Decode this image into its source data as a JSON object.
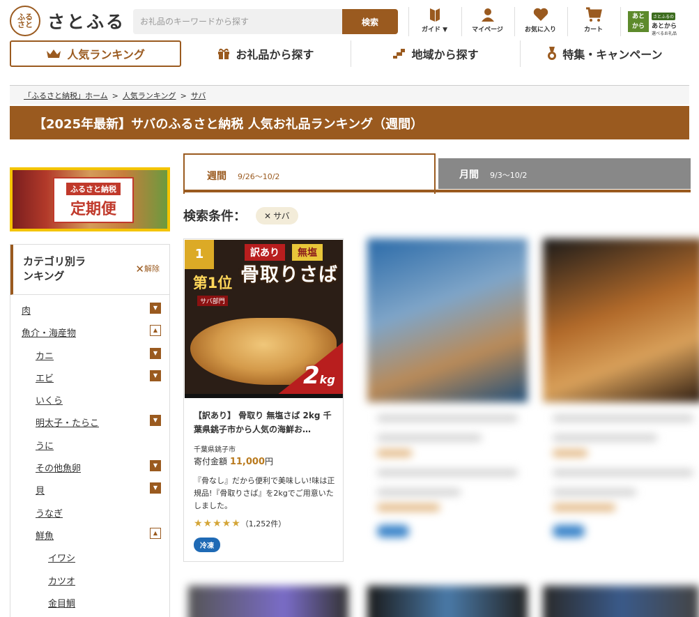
{
  "header": {
    "logo_text": "さとふる",
    "logo_mark": "ふるさと",
    "search_placeholder": "お礼品のキーワードから探す",
    "search_button": "検索",
    "nav": [
      {
        "label": "ガイド ▼",
        "icon": "book-icon"
      },
      {
        "label": "マイページ",
        "icon": "user-icon"
      },
      {
        "label": "お気に入り",
        "icon": "heart-icon"
      },
      {
        "label": "カート",
        "icon": "cart-icon"
      }
    ],
    "atokara": {
      "box": "あと から",
      "tag": "さとふるの",
      "name": "あとから",
      "sub": "選べるお礼品"
    }
  },
  "main_nav": [
    {
      "label": "人気ランキング",
      "icon": "crown-icon",
      "active": true
    },
    {
      "label": "お礼品から探す",
      "icon": "gift-icon",
      "active": false
    },
    {
      "label": "地域から探す",
      "icon": "map-icon",
      "active": false
    },
    {
      "label": "特集・キャンペーン",
      "icon": "medal-icon",
      "active": false
    }
  ],
  "breadcrumb": [
    "「ふるさと納税」ホーム",
    "人気ランキング",
    "サバ"
  ],
  "page_title": "【2025年最新】サバのふるさと納税 人気お礼品ランキング（週間）",
  "banner": {
    "line1": "ふるさと納税",
    "line2": "定期便"
  },
  "category_panel": {
    "title": "カテゴリ別ランキング",
    "clear_label": "解除",
    "items": [
      {
        "label": "肉",
        "level": 0,
        "toggle": "closed"
      },
      {
        "label": "魚介・海産物",
        "level": 0,
        "toggle": "open"
      },
      {
        "label": "カニ",
        "level": 1,
        "toggle": "closed"
      },
      {
        "label": "エビ",
        "level": 1,
        "toggle": "closed"
      },
      {
        "label": "いくら",
        "level": 1,
        "toggle": "none"
      },
      {
        "label": "明太子・たらこ",
        "level": 1,
        "toggle": "closed"
      },
      {
        "label": "うに",
        "level": 1,
        "toggle": "none"
      },
      {
        "label": "その他魚卵",
        "level": 1,
        "toggle": "closed"
      },
      {
        "label": "貝",
        "level": 1,
        "toggle": "closed"
      },
      {
        "label": "うなぎ",
        "level": 1,
        "toggle": "none"
      },
      {
        "label": "鮮魚",
        "level": 1,
        "toggle": "open"
      },
      {
        "label": "イワシ",
        "level": 2,
        "toggle": "none"
      },
      {
        "label": "カツオ",
        "level": 2,
        "toggle": "none"
      },
      {
        "label": "金目鯛",
        "level": 2,
        "toggle": "none"
      }
    ]
  },
  "tabs": {
    "weekly": {
      "label": "週間",
      "range": "9/26〜10/2"
    },
    "monthly": {
      "label": "月間",
      "range": "9/3〜10/2"
    }
  },
  "search_conditions": {
    "label": "検索条件：",
    "chip_x": "✕",
    "chip": "サバ"
  },
  "cards": [
    {
      "rank": "1",
      "image": {
        "tag_red": "訳あり",
        "tag_gold": "無塩",
        "headline": "骨取りさば",
        "rank_badge_top": "第1位",
        "rank_badge_sub": "サバ部門",
        "weight": "2",
        "weight_unit": "kg"
      },
      "title": "【訳あり】 骨取り 無塩さば 2kg 千葉県銚子市から人気の海鮮お…",
      "region": "千葉県銚子市",
      "price_label": "寄付金額",
      "price": "11,000",
      "price_unit": "円",
      "description": "『骨なし』だから便利で美味しい!味は正規品!『骨取りさば』を2kgでご用意いたしました。",
      "stars": "★★★★★",
      "reviews": "（1,252件）",
      "badge": "冷凍"
    }
  ]
}
